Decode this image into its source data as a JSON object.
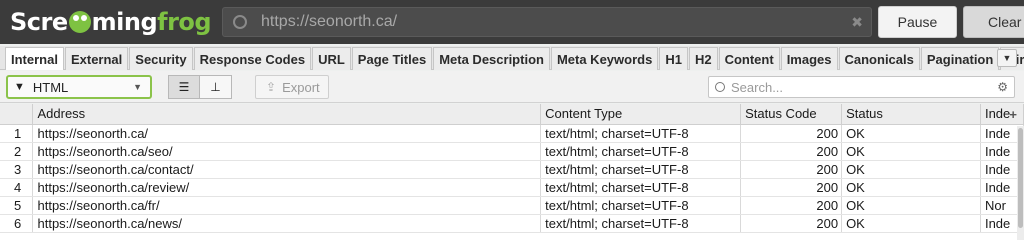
{
  "app": {
    "logo_part1": "Scre",
    "logo_part2": "ming",
    "logo_part3": "frog",
    "url": "https://seonorth.ca/",
    "pause_label": "Pause",
    "clear_label": "Clear",
    "colors": {
      "accent_green": "#7ec242",
      "topbar": "#3b3b3b"
    }
  },
  "tabs": [
    {
      "label": "Internal",
      "active": true
    },
    {
      "label": "External"
    },
    {
      "label": "Security"
    },
    {
      "label": "Response Codes"
    },
    {
      "label": "URL"
    },
    {
      "label": "Page Titles"
    },
    {
      "label": "Meta Description"
    },
    {
      "label": "Meta Keywords"
    },
    {
      "label": "H1"
    },
    {
      "label": "H2"
    },
    {
      "label": "Content"
    },
    {
      "label": "Images"
    },
    {
      "label": "Canonicals"
    },
    {
      "label": "Pagination"
    },
    {
      "label": "Dir"
    }
  ],
  "toolbar": {
    "filter_value": "HTML",
    "export_label": "Export",
    "search_placeholder": "Search..."
  },
  "table": {
    "columns": [
      "",
      "Address",
      "Content Type",
      "Status Code",
      "Status",
      "Inde"
    ],
    "rows": [
      {
        "n": "1",
        "address": "https://seonorth.ca/",
        "type": "text/html; charset=UTF-8",
        "code": "200",
        "status": "OK",
        "idx": "Inde"
      },
      {
        "n": "2",
        "address": "https://seonorth.ca/seo/",
        "type": "text/html; charset=UTF-8",
        "code": "200",
        "status": "OK",
        "idx": "Inde"
      },
      {
        "n": "3",
        "address": "https://seonorth.ca/contact/",
        "type": "text/html; charset=UTF-8",
        "code": "200",
        "status": "OK",
        "idx": "Inde"
      },
      {
        "n": "4",
        "address": "https://seonorth.ca/review/",
        "type": "text/html; charset=UTF-8",
        "code": "200",
        "status": "OK",
        "idx": "Inde"
      },
      {
        "n": "5",
        "address": "https://seonorth.ca/fr/",
        "type": "text/html; charset=UTF-8",
        "code": "200",
        "status": "OK",
        "idx": "Nor"
      },
      {
        "n": "6",
        "address": "https://seonorth.ca/news/",
        "type": "text/html; charset=UTF-8",
        "code": "200",
        "status": "OK",
        "idx": "Inde"
      }
    ]
  },
  "icons": [
    "globe-icon",
    "clear-icon",
    "funnel-icon",
    "chevron-down-icon",
    "list-view-icon",
    "tree-view-icon",
    "upload-icon",
    "search-icon",
    "sliders-icon",
    "add-column-icon"
  ]
}
